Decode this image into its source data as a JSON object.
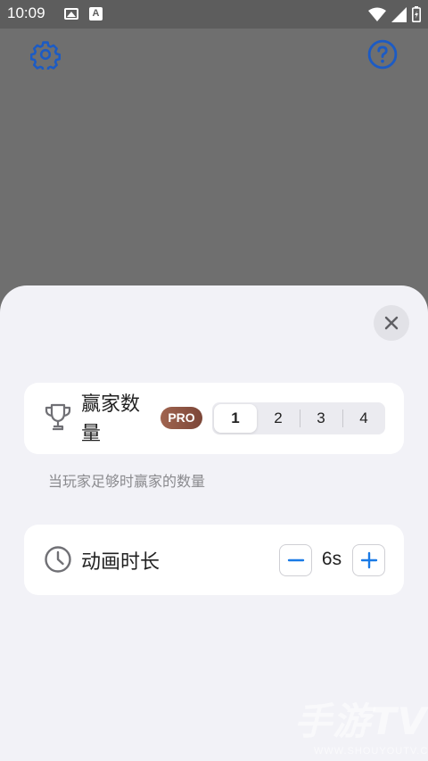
{
  "status_bar": {
    "time": "10:09",
    "left_icons": [
      "image-icon",
      "a-icon"
    ],
    "right_icons": [
      "wifi-icon",
      "signal-icon",
      "battery-icon"
    ]
  },
  "top_bar": {
    "icons": [
      "gear-icon",
      "help-icon"
    ],
    "accent_color": "#1c5bc4"
  },
  "sheet": {
    "close_icon": "close-icon",
    "winners": {
      "icon": "trophy-icon",
      "label": "赢家数量",
      "pro_badge": "PRO",
      "options": [
        "1",
        "2",
        "3",
        "4"
      ],
      "selected": "1",
      "hint": "当玩家足够时赢家的数量"
    },
    "animation": {
      "icon": "clock-icon",
      "label": "动画时长",
      "minus_icon": "minus-icon",
      "plus_icon": "plus-icon",
      "value": "6s"
    }
  },
  "watermark": {
    "main": "手游TV",
    "sub": "WWW.SHOUYOUTV.COM"
  }
}
